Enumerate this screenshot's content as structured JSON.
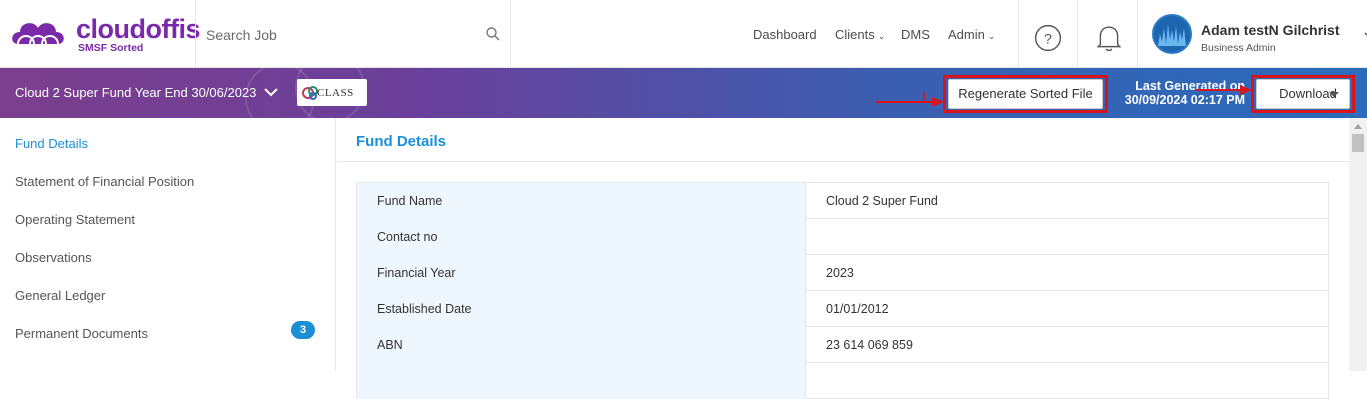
{
  "header": {
    "logo_text": "cloudoffis",
    "logo_subtext": "SMSF Sorted",
    "search": {
      "placeholder": "Search Job"
    },
    "nav": [
      {
        "label": "Dashboard"
      },
      {
        "label": "Clients"
      },
      {
        "label": "DMS"
      },
      {
        "label": "Admin"
      }
    ],
    "user": {
      "name": "Adam testN Gilchrist",
      "role": "Business Admin"
    }
  },
  "banner": {
    "title": "Cloud 2 Super Fund Year End 30/06/2023",
    "class_logo_text": "CLASS",
    "regenerate_label": "Regenerate Sorted File",
    "last_generated_label": "Last Generated on",
    "last_generated_value": "30/09/2024 02:17 PM",
    "download_label": "Download"
  },
  "sidebar": {
    "items": [
      {
        "label": "Fund Details"
      },
      {
        "label": "Statement of Financial Position"
      },
      {
        "label": "Operating Statement"
      },
      {
        "label": "Observations"
      },
      {
        "label": "General Ledger"
      },
      {
        "label": "Permanent Documents",
        "badge": "3"
      }
    ]
  },
  "main": {
    "title": "Fund Details",
    "rows": [
      {
        "key": "Fund Name",
        "value": "Cloud 2 Super Fund"
      },
      {
        "key": "Contact no",
        "value": ""
      },
      {
        "key": "Financial Year",
        "value": "2023"
      },
      {
        "key": "Established Date",
        "value": "01/01/2012"
      },
      {
        "key": "ABN",
        "value": "23 614 069 859"
      }
    ]
  },
  "colors": {
    "brand_purple": "#7a2aa8",
    "accent_blue": "#1a8fd6",
    "highlight_red": "#d8141c"
  }
}
